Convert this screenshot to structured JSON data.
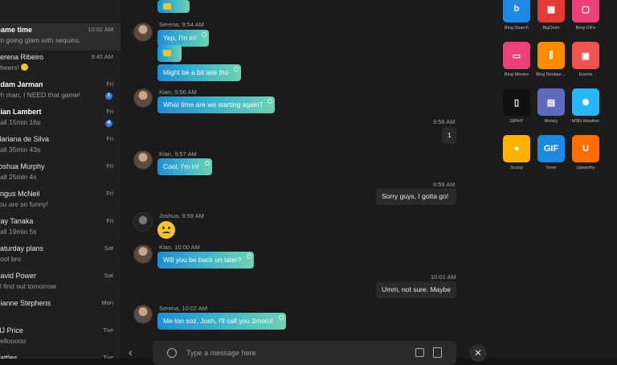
{
  "conversations": [
    {
      "name": "Game time",
      "preview": "I'm going glam with sequins.",
      "time": "10:02 AM",
      "bold": true,
      "active": true
    },
    {
      "name": "Serena Ribeiro",
      "preview": "Cheers!",
      "time": "9:45 AM",
      "emoji": true
    },
    {
      "name": "Adam Jarman",
      "preview": "Oh man, I NEED that game!",
      "time": "Fri",
      "bold": true,
      "badge": "1"
    },
    {
      "name": "Kian Lambert",
      "preview": "Call 15min 16s",
      "time": "Fri",
      "bold": true,
      "badge": "4"
    },
    {
      "name": "Mariana de Silva",
      "preview": "Call 35min 43s",
      "time": "Fri"
    },
    {
      "name": "Joshua Murphy",
      "preview": "Call 25min 4s",
      "time": "Fri"
    },
    {
      "name": "Angus McNeil",
      "preview": "You are so funny!",
      "time": "Fri"
    },
    {
      "name": "Ray Tanaka",
      "preview": "Call 19min 5s",
      "time": "Fri"
    },
    {
      "name": "Saturday plans",
      "preview": "Cool bro",
      "time": "Sat"
    },
    {
      "name": "David Power",
      "preview": "I'll find out tomorrow",
      "time": "Sat"
    },
    {
      "name": "Dianne Stephens",
      "preview": "",
      "time": "Mon"
    },
    {
      "name": "MJ Price",
      "preview": "Hellooooo",
      "time": "Tue"
    },
    {
      "name": "Battles",
      "preview": "",
      "time": "Tue"
    }
  ],
  "messages": {
    "m1_meta": "Serena, 9:54 AM",
    "m1_b1": "Yep, I'm in!",
    "m1_b3": "Might be a bit late tho",
    "m2_meta": "Kian, 9:56 AM",
    "m2_b1": "What time are we starting again?",
    "m3_time": "9:56 AM",
    "m3_b1": "1",
    "m4_meta": "Kian, 9:57 AM",
    "m4_b1": "Cool. I'm in!",
    "m5_time": "9:59 AM",
    "m5_b1": "Sorry guys, I gotta go!",
    "m6_meta": "Joshua, 9:59 AM",
    "m7_meta": "Kian, 10:00 AM",
    "m7_b1": "Will you be back on later?",
    "m8_time": "10:01 AM",
    "m8_b1": "Umm, not sure. Maybe",
    "m9_meta": "Serena, 10:02 AM",
    "m9_b1": "Me too soz. Josh, I'll call you 2moro!"
  },
  "input": {
    "placeholder": "Type a message here"
  },
  "apps": [
    {
      "label": "Bing Search",
      "color": "#1e88e5",
      "glyph": "b"
    },
    {
      "label": "BigOven",
      "color": "#e53935",
      "glyph": "▦"
    },
    {
      "label": "Bing GIFs",
      "color": "#ec407a",
      "glyph": "▢"
    },
    {
      "label": "Bing Movies",
      "color": "#ec407a",
      "glyph": "▭"
    },
    {
      "label": "Bing Restaur…",
      "color": "#fb8c00",
      "glyph": "⫼"
    },
    {
      "label": "Events",
      "color": "#ef5350",
      "glyph": "▣"
    },
    {
      "label": "GIPHY",
      "color": "#111111",
      "glyph": "▯"
    },
    {
      "label": "Money",
      "color": "#5c6bc0",
      "glyph": "▤"
    },
    {
      "label": "MSN Weather",
      "color": "#29b6f6",
      "glyph": "✺"
    },
    {
      "label": "Scoop",
      "color": "#ffb300",
      "glyph": "●"
    },
    {
      "label": "Tenor",
      "color": "#1e88e5",
      "glyph": "GIF"
    },
    {
      "label": "Upworthy",
      "color": "#ff6f00",
      "glyph": "U"
    }
  ]
}
